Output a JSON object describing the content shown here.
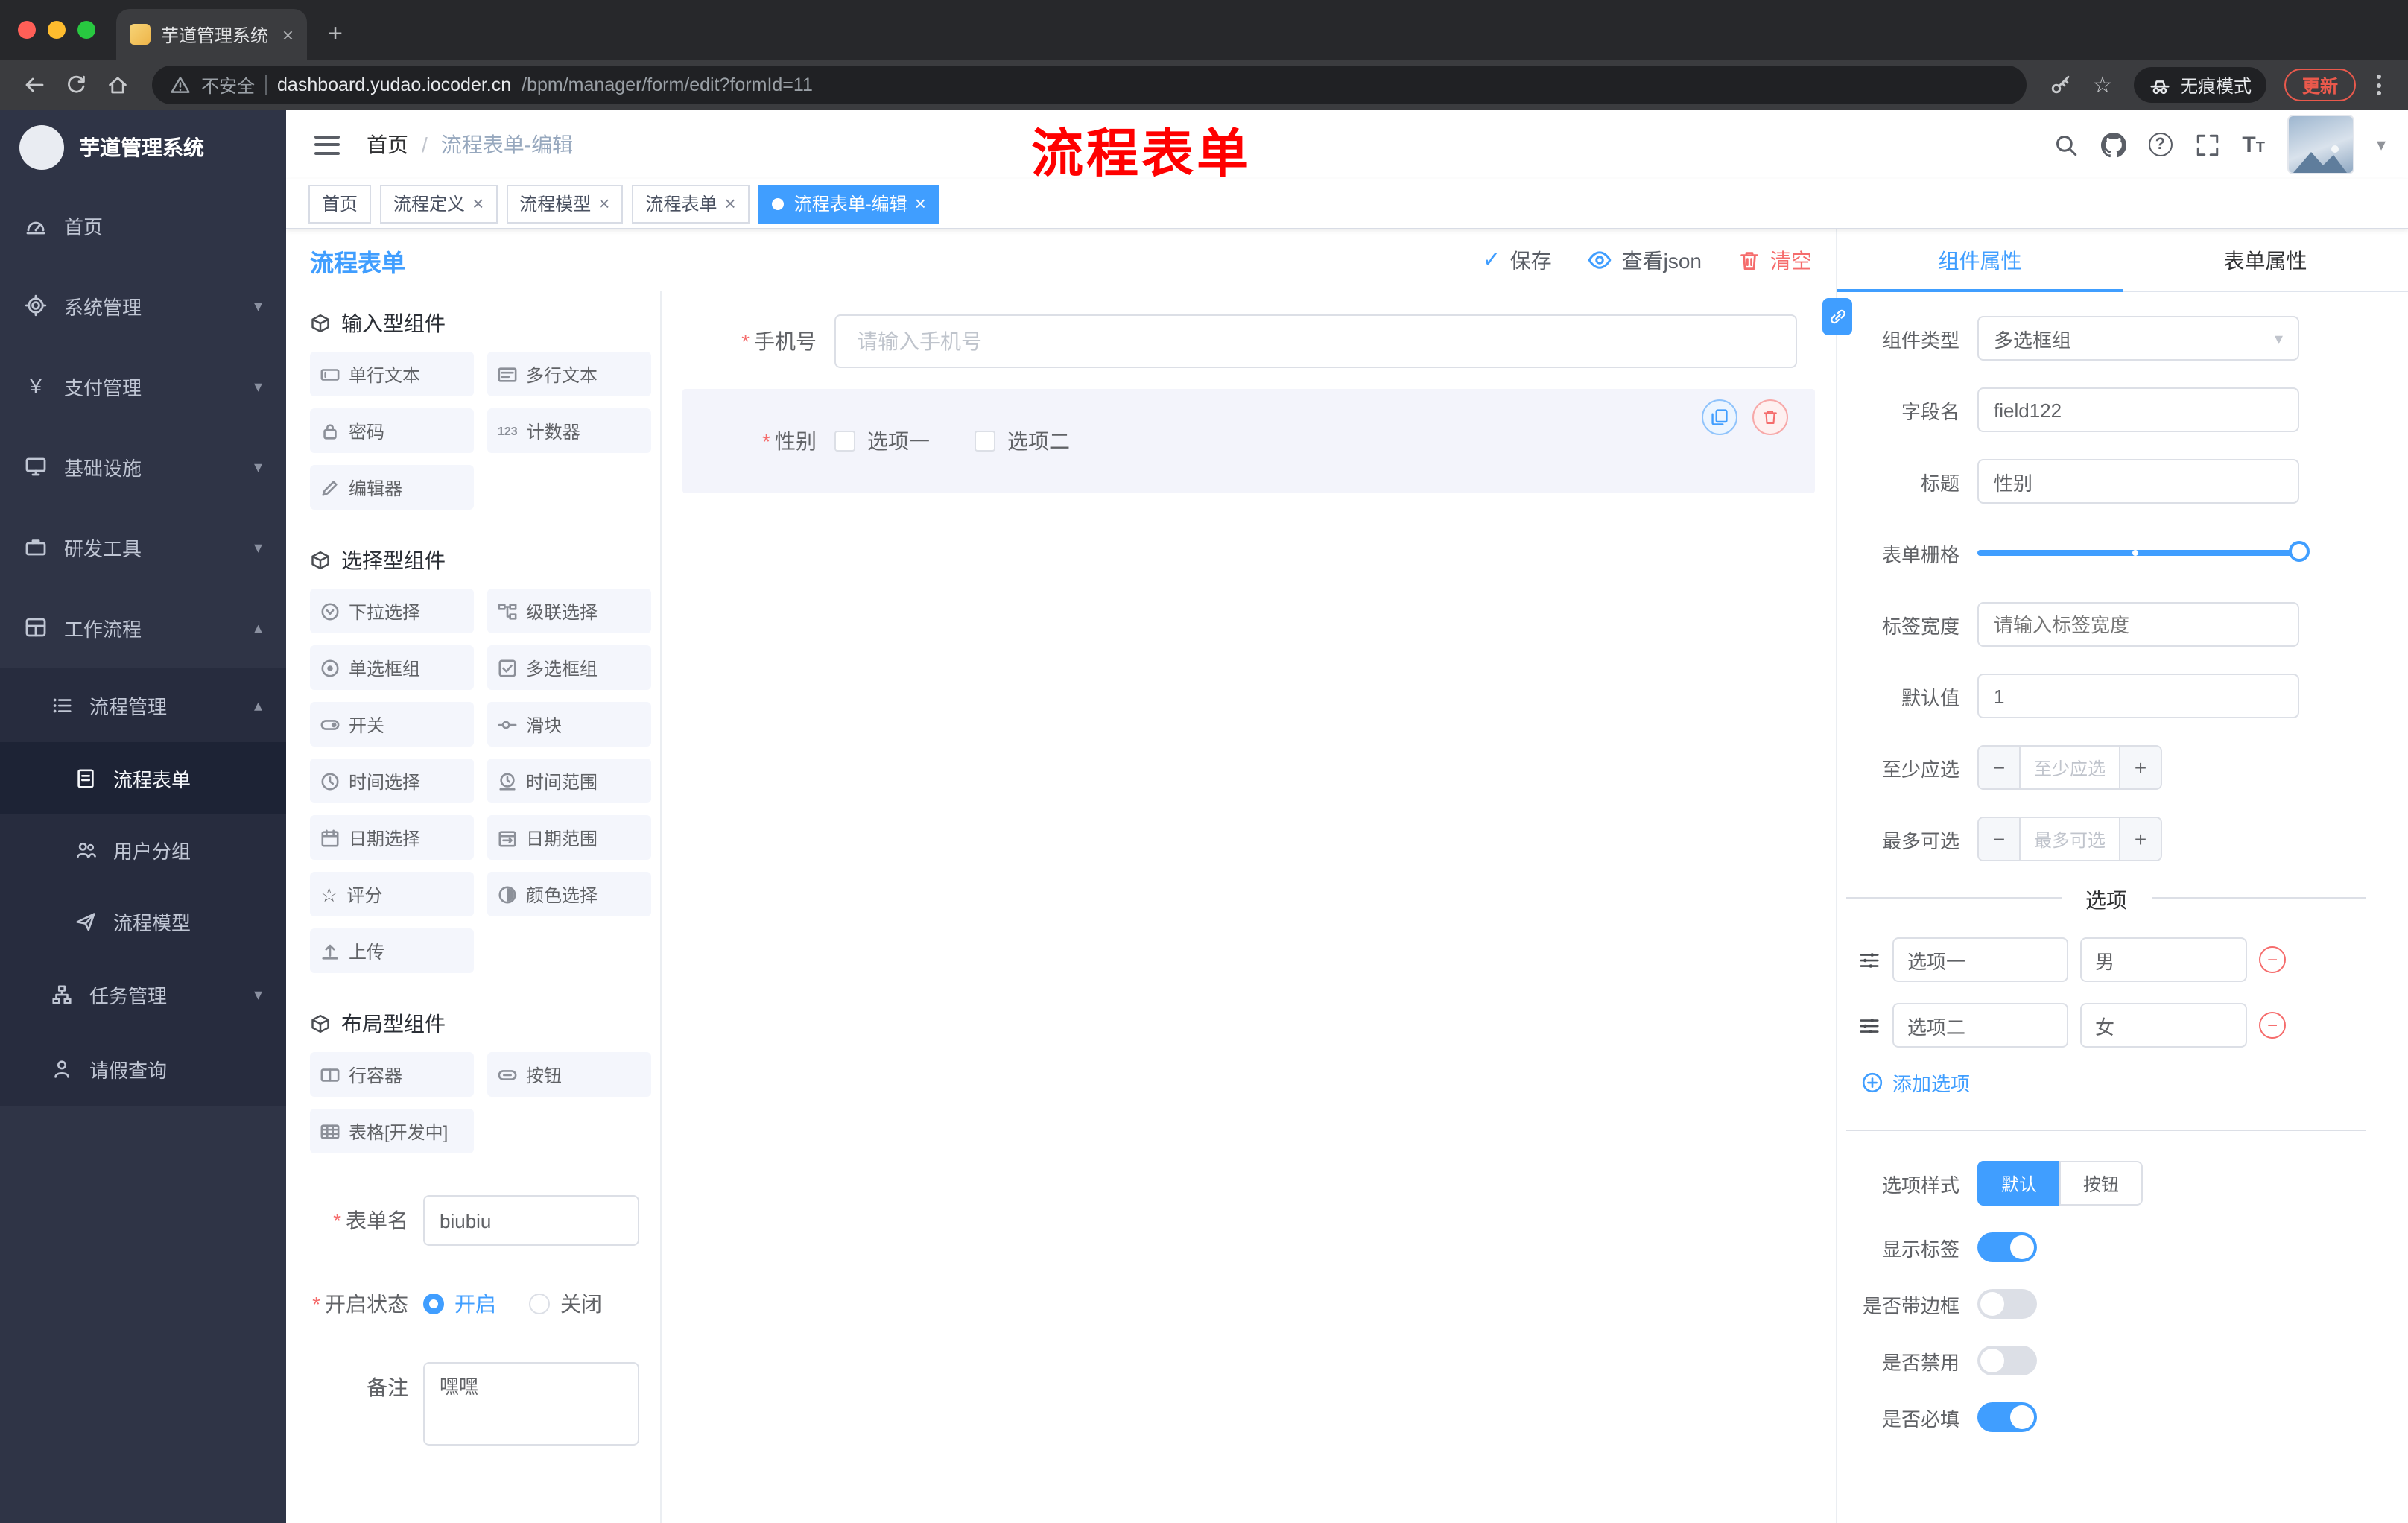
{
  "glyphs": {
    "star": "*",
    "close": "×",
    "plus": "+",
    "minus": "−",
    "dots_v": "⋮",
    "caret_down": "▾",
    "caret_up": "▴",
    "check": "✓",
    "slash": "/",
    "question": "?",
    "font_big": "T",
    "font_small": "T",
    "yen": "¥",
    "star_outline": "☆",
    "counter": "123"
  },
  "browser": {
    "tab_title": "芋道管理系统",
    "security_label": "不安全",
    "url_domain": "dashboard.yudao.iocoder.cn",
    "url_path": "/bpm/manager/form/edit?formId=11",
    "incognito_label": "无痕模式",
    "update_label": "更新"
  },
  "annotation": {
    "text": "流程表单"
  },
  "sidebar": {
    "logo_title": "芋道管理系统",
    "items": [
      {
        "label": "首页"
      },
      {
        "label": "系统管理"
      },
      {
        "label": "支付管理"
      },
      {
        "label": "基础设施"
      },
      {
        "label": "研发工具"
      },
      {
        "label": "工作流程"
      },
      {
        "label": "流程管理"
      },
      {
        "label": "流程表单"
      },
      {
        "label": "用户分组"
      },
      {
        "label": "流程模型"
      },
      {
        "label": "任务管理"
      },
      {
        "label": "请假查询"
      }
    ]
  },
  "navbar": {
    "breadcrumb_home": "首页",
    "breadcrumb_current": "流程表单-编辑"
  },
  "tags": [
    {
      "label": "首页"
    },
    {
      "label": "流程定义"
    },
    {
      "label": "流程模型"
    },
    {
      "label": "流程表单"
    },
    {
      "label": "流程表单-编辑"
    }
  ],
  "toolbar": {
    "page_title": "流程表单",
    "save_label": "保存",
    "json_label": "查看json",
    "clear_label": "清空"
  },
  "palette": {
    "group1_title": "输入型组件",
    "group2_title": "选择型组件",
    "group3_title": "布局型组件",
    "group1": [
      "单行文本",
      "多行文本",
      "密码",
      "计数器",
      "编辑器"
    ],
    "group2": [
      "下拉选择",
      "级联选择",
      "单选框组",
      "多选框组",
      "开关",
      "滑块",
      "时间选择",
      "时间范围",
      "日期选择",
      "日期范围",
      "评分",
      "颜色选择",
      "上传"
    ],
    "group3": [
      "行容器",
      "按钮",
      "表格[开发中]"
    ],
    "form": {
      "name_label": "表单名",
      "name_value": "biubiu",
      "status_label": "开启状态",
      "status_on": "开启",
      "status_off": "关闭",
      "remark_label": "备注",
      "remark_value": "嘿嘿"
    }
  },
  "canvas": {
    "phone_label": "手机号",
    "phone_placeholder": "请输入手机号",
    "gender_label": "性别",
    "gender_option1": "选项一",
    "gender_option2": "选项二"
  },
  "inspector": {
    "tab_component": "组件属性",
    "tab_form": "表单属性",
    "type_label": "组件类型",
    "type_value": "多选框组",
    "field_label": "字段名",
    "field_value": "field122",
    "title_label": "标题",
    "title_value": "性别",
    "grid_label": "表单栅格",
    "labelwidth_label": "标签宽度",
    "labelwidth_placeholder": "请输入标签宽度",
    "default_label": "默认值",
    "default_value": "1",
    "min_label": "至少应选",
    "min_placeholder": "至少应选",
    "max_label": "最多可选",
    "max_placeholder": "最多可选",
    "options_divider": "选项",
    "option1_name": "选项一",
    "option1_value": "男",
    "option2_name": "选项二",
    "option2_value": "女",
    "add_option": "添加选项",
    "style_label": "选项样式",
    "style_default": "默认",
    "style_button": "按钮",
    "show_label": "显示标签",
    "border_label": "是否带边框",
    "disabled_label": "是否禁用",
    "required_label": "是否必填"
  },
  "colors": {
    "accent": "#409eff",
    "danger": "#f56c6c",
    "annotation": "#ff0000"
  }
}
